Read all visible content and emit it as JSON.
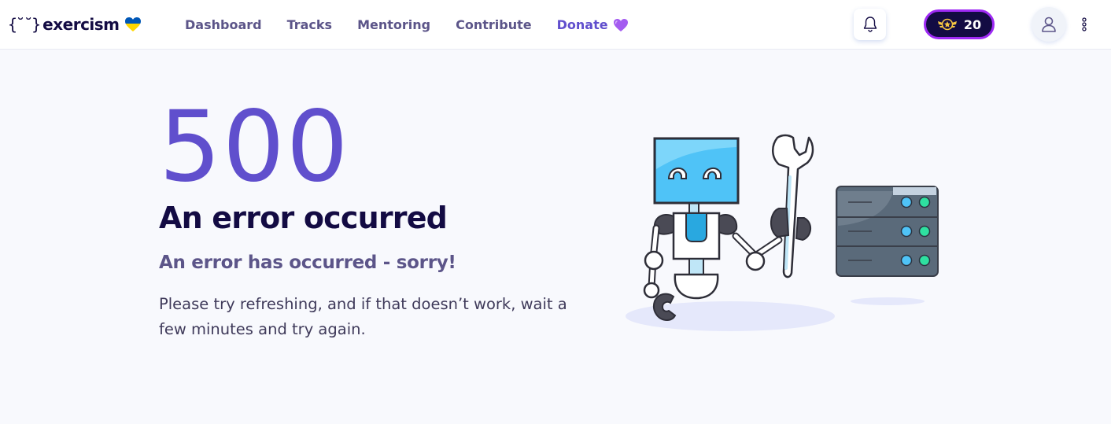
{
  "brand": {
    "name": "exercism",
    "braces": "{˘˘}"
  },
  "nav": {
    "items": [
      "Dashboard",
      "Tracks",
      "Mentoring",
      "Contribute"
    ],
    "donate": "Donate"
  },
  "header": {
    "reputation": "20",
    "icons": {
      "notifications": "bell-icon",
      "reputation": "reputation-badge-icon",
      "avatar": "user-icon",
      "menu": "more-vertical-icon"
    }
  },
  "error": {
    "code": "500",
    "title": "An error occurred",
    "subtitle": "An error has occurred - sorry!",
    "message": "Please try refreshing, and if that doesn’t work, wait a few minutes and try again."
  },
  "colors": {
    "accent": "#604FCD",
    "heading": "#130B43",
    "muted": "#5C5589",
    "background": "#F8F9FD",
    "reputation_border": "#9E2AF4",
    "robot_screen": "#4FC3F7",
    "server": "#5A6A7A",
    "led": "#2EE0A0"
  }
}
